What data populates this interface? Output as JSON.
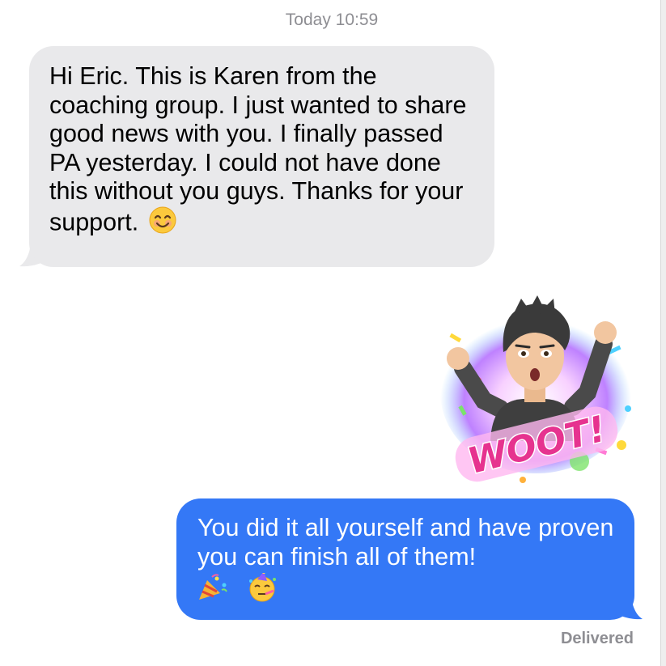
{
  "thread": {
    "timestamp": "Today 10:59",
    "messages": [
      {
        "direction": "incoming",
        "text": "Hi Eric. This is Karen from the coaching group. I just wanted to share good news with you. I finally passed PA yesterday. I could not have done this without you guys. Thanks for your support.",
        "emoji": "smiling-face-icon"
      },
      {
        "direction": "outgoing",
        "type": "sticker",
        "sticker_text": "WOOT!",
        "sticker_icon": "memoji-celebration-sticker"
      },
      {
        "direction": "outgoing",
        "text": "You did it all yourself and have proven you can finish all of them!",
        "emojis": [
          "party-popper-icon",
          "partying-face-icon"
        ]
      }
    ],
    "status": "Delivered"
  },
  "colors": {
    "incoming_bubble": "#e9e9eb",
    "outgoing_bubble": "#3478f6",
    "meta_text": "#8e8e93",
    "sticker_pink": "#e6338f"
  }
}
